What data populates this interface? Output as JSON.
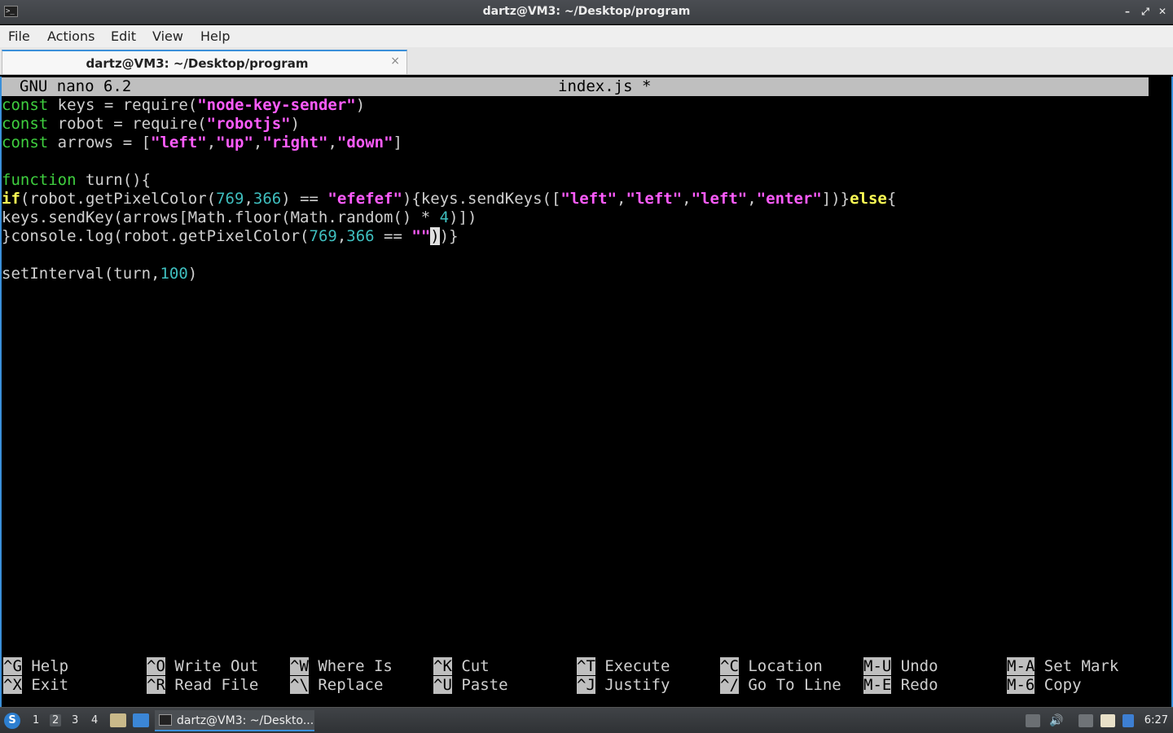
{
  "window": {
    "title": "dartz@VM3: ~/Desktop/program",
    "minimize_glyph": "–",
    "maximize_glyph": "⤢",
    "close_glyph": "✕"
  },
  "menu": [
    "File",
    "Actions",
    "Edit",
    "View",
    "Help"
  ],
  "tab": {
    "title": "dartz@VM3: ~/Desktop/program",
    "close_glyph": "×"
  },
  "nano": {
    "version": "GNU nano 6.2",
    "filename": "index.js *",
    "code_lines": [
      [
        {
          "t": "const",
          "c": "kw"
        },
        {
          "t": " keys = require("
        },
        {
          "t": "\"node-key-sender\"",
          "c": "str"
        },
        {
          "t": ")"
        }
      ],
      [
        {
          "t": "const",
          "c": "kw"
        },
        {
          "t": " robot = require("
        },
        {
          "t": "\"robotjs\"",
          "c": "str"
        },
        {
          "t": ")"
        }
      ],
      [
        {
          "t": "const",
          "c": "kw"
        },
        {
          "t": " arrows = ["
        },
        {
          "t": "\"left\"",
          "c": "str"
        },
        {
          "t": ","
        },
        {
          "t": "\"up\"",
          "c": "str"
        },
        {
          "t": ","
        },
        {
          "t": "\"right\"",
          "c": "str"
        },
        {
          "t": ","
        },
        {
          "t": "\"down\"",
          "c": "str"
        },
        {
          "t": "]"
        }
      ],
      [],
      [
        {
          "t": "function",
          "c": "kw"
        },
        {
          "t": " turn(){"
        }
      ],
      [
        {
          "t": "if",
          "c": "ctl"
        },
        {
          "t": "(robot.getPixelColor("
        },
        {
          "t": "769",
          "c": "num"
        },
        {
          "t": ","
        },
        {
          "t": "366",
          "c": "num"
        },
        {
          "t": ") == "
        },
        {
          "t": "\"efefef\"",
          "c": "str"
        },
        {
          "t": "){keys.sendKeys(["
        },
        {
          "t": "\"left\"",
          "c": "str"
        },
        {
          "t": ","
        },
        {
          "t": "\"left\"",
          "c": "str"
        },
        {
          "t": ","
        },
        {
          "t": "\"left\"",
          "c": "str"
        },
        {
          "t": ","
        },
        {
          "t": "\"enter\"",
          "c": "str"
        },
        {
          "t": "])}"
        },
        {
          "t": "else",
          "c": "ctl"
        },
        {
          "t": "{"
        }
      ],
      [
        {
          "t": "keys.sendKey(arrows[Math.floor(Math.random() * "
        },
        {
          "t": "4",
          "c": "num"
        },
        {
          "t": ")])"
        }
      ],
      [
        {
          "t": "}console.log(robot.getPixelColor("
        },
        {
          "t": "769",
          "c": "num"
        },
        {
          "t": ","
        },
        {
          "t": "366",
          "c": "num"
        },
        {
          "t": " == "
        },
        {
          "t": "\"\"",
          "c": "str"
        },
        {
          "t": ")",
          "c": "cursor"
        },
        {
          "t": ")}"
        }
      ],
      [],
      [
        {
          "t": "setInterval(turn,"
        },
        {
          "t": "100",
          "c": "num"
        },
        {
          "t": ")"
        }
      ]
    ],
    "shortcuts": [
      {
        "key": "^G",
        "label": "Help"
      },
      {
        "key": "^O",
        "label": "Write Out"
      },
      {
        "key": "^W",
        "label": "Where Is"
      },
      {
        "key": "^K",
        "label": "Cut"
      },
      {
        "key": "^T",
        "label": "Execute"
      },
      {
        "key": "^C",
        "label": "Location"
      },
      {
        "key": "M-U",
        "label": "Undo"
      },
      {
        "key": "M-A",
        "label": "Set Mark"
      },
      {
        "key": "^X",
        "label": "Exit"
      },
      {
        "key": "^R",
        "label": "Read File"
      },
      {
        "key": "^\\",
        "label": "Replace"
      },
      {
        "key": "^U",
        "label": "Paste"
      },
      {
        "key": "^J",
        "label": "Justify"
      },
      {
        "key": "^/",
        "label": "Go To Line"
      },
      {
        "key": "M-E",
        "label": "Redo"
      },
      {
        "key": "M-6",
        "label": "Copy"
      }
    ]
  },
  "taskbar": {
    "workspaces": [
      "1",
      "2",
      "3",
      "4"
    ],
    "active_workspace": "2",
    "task_label": "dartz@VM3: ~/Deskto...",
    "clock": "6:27"
  }
}
